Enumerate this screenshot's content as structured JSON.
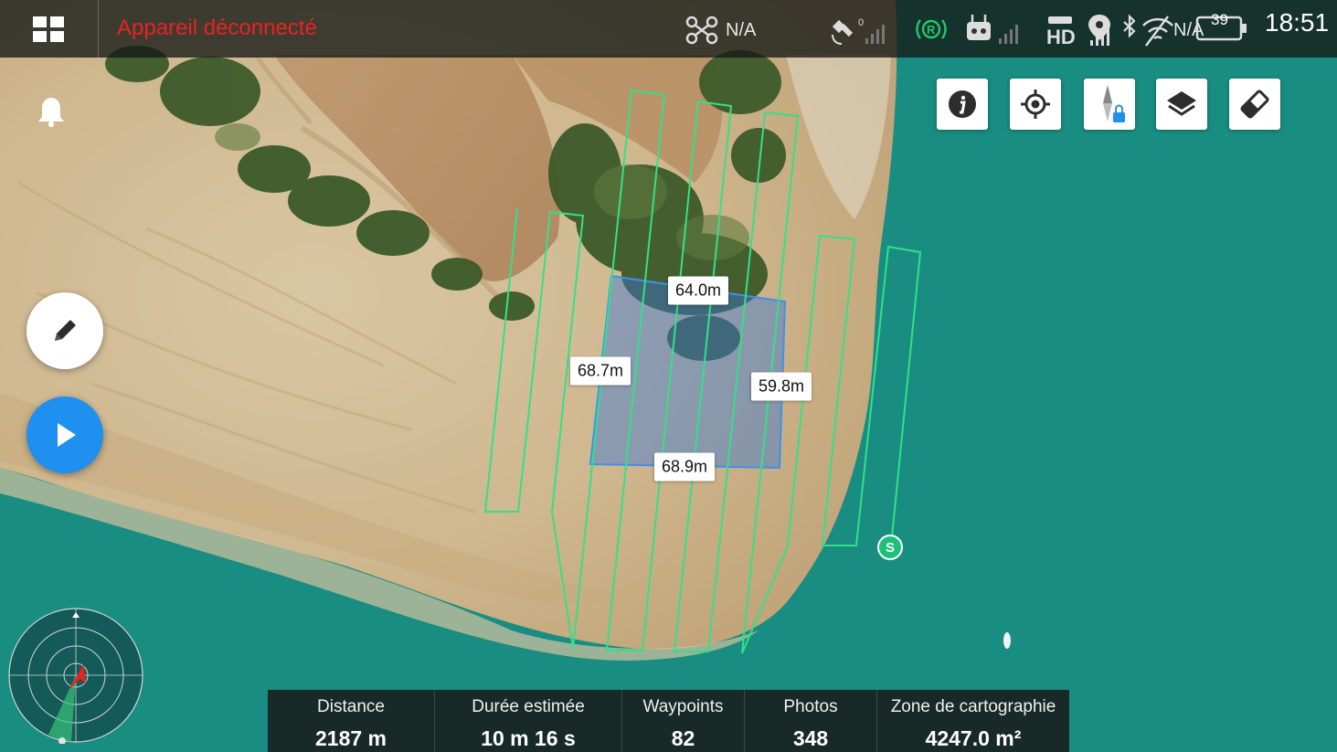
{
  "status_bar": {
    "connection_status": "Appareil déconnecté",
    "drone_value": "N/A",
    "satellite_count": "0",
    "rc_badge": "R",
    "hd_label": "HD",
    "wifi_value": "N/A",
    "battery_level": "39",
    "time": "18:51",
    "colors": {
      "warning": "#e8231f",
      "rc_ok": "#23c46b"
    }
  },
  "toolbar": {
    "icons": [
      "info-icon",
      "locate-icon",
      "compass-lock-icon",
      "layers-icon",
      "eraser-icon"
    ]
  },
  "left_controls": {
    "icons": [
      "bell-icon",
      "pencil-icon",
      "play-icon"
    ],
    "play_color": "#1f8ff0"
  },
  "map": {
    "measurements": {
      "top": "64.0m",
      "left": "68.7m",
      "right": "59.8m",
      "bottom": "68.9m"
    },
    "start_marker": "S",
    "colors": {
      "flight_path": "#33e08a",
      "area": "#3a78d6"
    }
  },
  "stats": [
    {
      "label": "Distance",
      "value": "2187 m"
    },
    {
      "label": "Durée estimée",
      "value": "10 m 16 s"
    },
    {
      "label": "Waypoints",
      "value": "82"
    },
    {
      "label": "Photos",
      "value": "348"
    },
    {
      "label": "Zone de cartographie",
      "value": "4247.0 m²"
    }
  ]
}
